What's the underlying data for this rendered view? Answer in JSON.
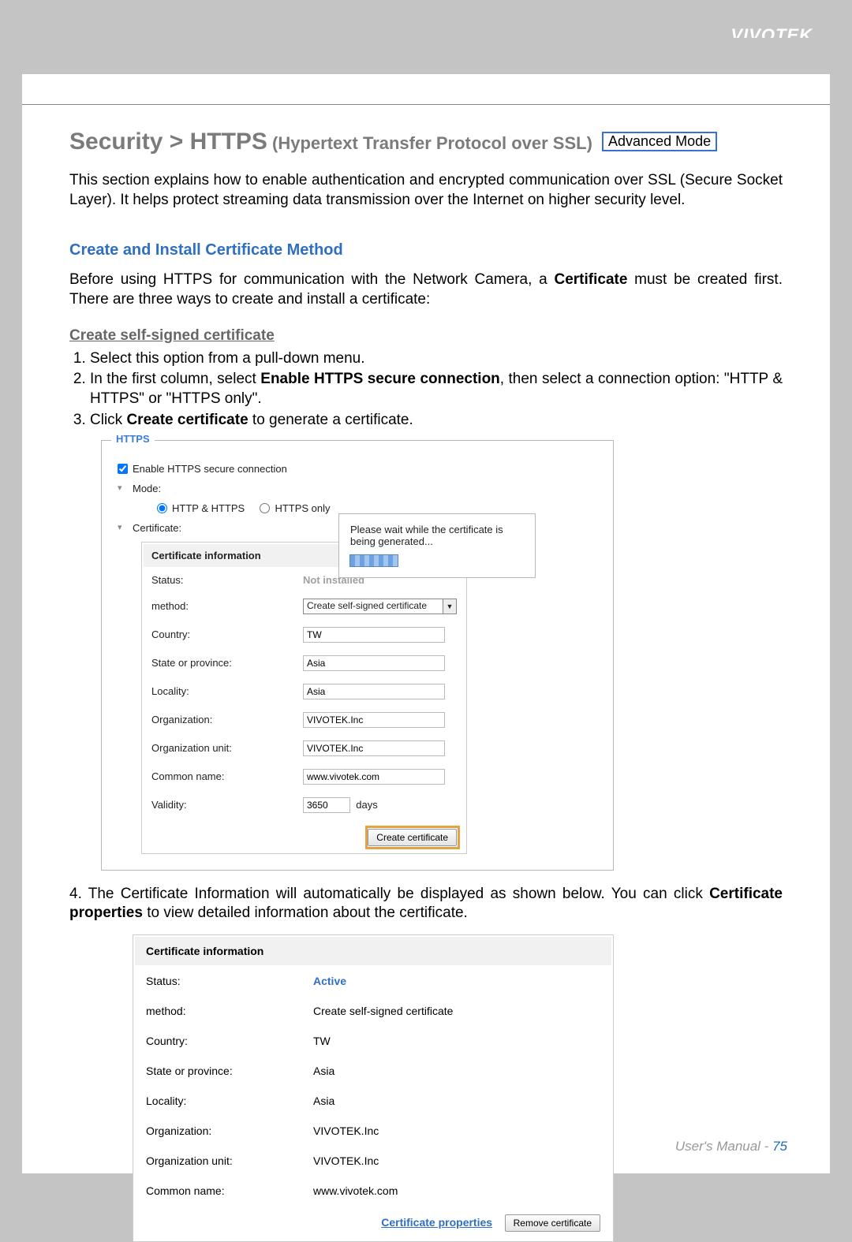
{
  "brand": "VIVOTEK",
  "h1_a": "Security >  HTTPS",
  "h1_b": " (Hypertext Transfer Protocol over SSL)  ",
  "mode_badge": "Advanced Mode",
  "intro": "This section explains how to enable authentication and encrypted communication over SSL (Secure Socket Layer). It helps protect streaming data transmission over the Internet on higher security level.",
  "section_h": "Create and Install Certificate Method",
  "body_p_a": "Before using HTTPS for communication with the Network Camera, a ",
  "body_p_b": "Certificate",
  "body_p_c": " must be created first. There are three ways to create and install a certificate:",
  "sub_h": "Create self-signed certificate",
  "steps": {
    "s1": "Select this option from a pull-down menu.",
    "s2a": "In the first column, select ",
    "s2b": "Enable HTTPS secure connection",
    "s2c": ", then select a connection option: \"HTTP & HTTPS\" or \"HTTPS only\".",
    "s3a": "Click ",
    "s3b": "Create certificate",
    "s3c": " to generate a certificate."
  },
  "panel": {
    "legend": "HTTPS",
    "enable_label": "Enable HTTPS secure connection",
    "mode_label": "Mode:",
    "radio_a": "HTTP & HTTPS",
    "radio_b": "HTTPS only",
    "cert_label": "Certificate:",
    "cert_header": "Certificate information",
    "rows": {
      "status_l": "Status:",
      "status_v": "Not installed",
      "method_l": "method:",
      "method_v": "Create self-signed certificate",
      "country_l": "Country:",
      "country_v": "TW",
      "state_l": "State or province:",
      "state_v": "Asia",
      "locality_l": "Locality:",
      "locality_v": "Asia",
      "org_l": "Organization:",
      "org_v": "VIVOTEK.Inc",
      "orgunit_l": "Organization unit:",
      "orgunit_v": "VIVOTEK.Inc",
      "cn_l": "Common name:",
      "cn_v": "www.vivotek.com",
      "valid_l": "Validity:",
      "valid_v": "3650",
      "valid_unit": "days"
    },
    "create_btn": "Create certificate",
    "gen_msg": "Please wait while the certificate is being generated..."
  },
  "step4_a": "4. The Certificate Information will automatically be displayed as shown below. You can click ",
  "step4_b": "Certificate properties",
  "step4_c": " to view detailed information about the certificate.",
  "info2": {
    "header": "Certificate information",
    "status_l": "Status:",
    "status_v": "Active",
    "method_l": "method:",
    "method_v": "Create self-signed certificate",
    "country_l": "Country:",
    "country_v": "TW",
    "state_l": "State or province:",
    "state_v": "Asia",
    "locality_l": "Locality:",
    "locality_v": "Asia",
    "org_l": "Organization:",
    "org_v": "VIVOTEK.Inc",
    "orgunit_l": "Organization unit:",
    "orgunit_v": "VIVOTEK.Inc",
    "cn_l": "Common name:",
    "cn_v": "www.vivotek.com",
    "cert_props": "Certificate properties",
    "remove_btn": "Remove certificate"
  },
  "footer_a": "User's Manual - ",
  "footer_b": "75"
}
